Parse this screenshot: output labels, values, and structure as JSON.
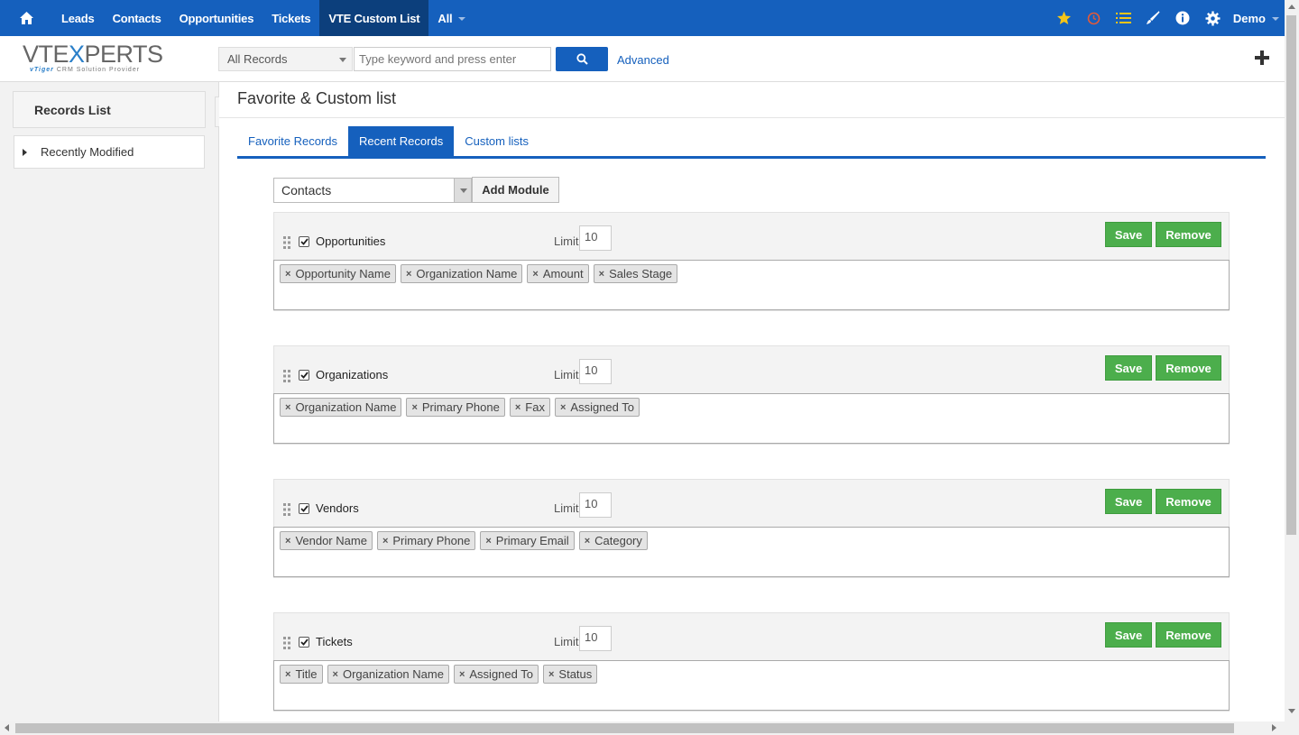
{
  "topnav": {
    "items": [
      {
        "label": "Leads"
      },
      {
        "label": "Contacts"
      },
      {
        "label": "Opportunities"
      },
      {
        "label": "Tickets"
      },
      {
        "label": "VTE Custom List",
        "active": true
      },
      {
        "label": "All"
      }
    ],
    "user": "Demo",
    "icons": [
      "home-icon",
      "star-icon",
      "clock-icon",
      "list-icon",
      "brush-icon",
      "info-icon",
      "gear-icon"
    ]
  },
  "header": {
    "logo": {
      "brand_left": "VTE",
      "brand_x": "X",
      "brand_right": "PERTS",
      "tag_v": "vTiger",
      "tag_rest": "CRM Solution Provider"
    },
    "record_scope": "All Records",
    "search_placeholder": "Type keyword and press enter",
    "advanced_label": "Advanced"
  },
  "sidebar": {
    "title": "Records List",
    "items": [
      {
        "label": "Recently Modified"
      }
    ]
  },
  "main": {
    "title": "Favorite & Custom list",
    "tabs": [
      {
        "label": "Favorite Records"
      },
      {
        "label": "Recent Records",
        "active": true
      },
      {
        "label": "Custom lists"
      }
    ],
    "module_select": "Contacts",
    "add_module_label": "Add Module",
    "limit_label": "Limit",
    "save_label": "Save",
    "remove_label": "Remove",
    "blocks": [
      {
        "name": "Opportunities",
        "checked": true,
        "limit": "10",
        "fields": [
          "Opportunity Name",
          "Organization Name",
          "Amount",
          "Sales Stage"
        ]
      },
      {
        "name": "Organizations",
        "checked": true,
        "limit": "10",
        "fields": [
          "Organization Name",
          "Primary Phone",
          "Fax",
          "Assigned To"
        ]
      },
      {
        "name": "Vendors",
        "checked": true,
        "limit": "10",
        "fields": [
          "Vendor Name",
          "Primary Phone",
          "Primary Email",
          "Category"
        ]
      },
      {
        "name": "Tickets",
        "checked": true,
        "limit": "10",
        "fields": [
          "Title",
          "Organization Name",
          "Assigned To",
          "Status"
        ]
      }
    ]
  },
  "colors": {
    "nav_blue": "#1560bd",
    "nav_active": "#0c3f7c",
    "success_green": "#4cae4c",
    "star_yellow": "#f5c518",
    "clock_red": "#e05a3a"
  }
}
